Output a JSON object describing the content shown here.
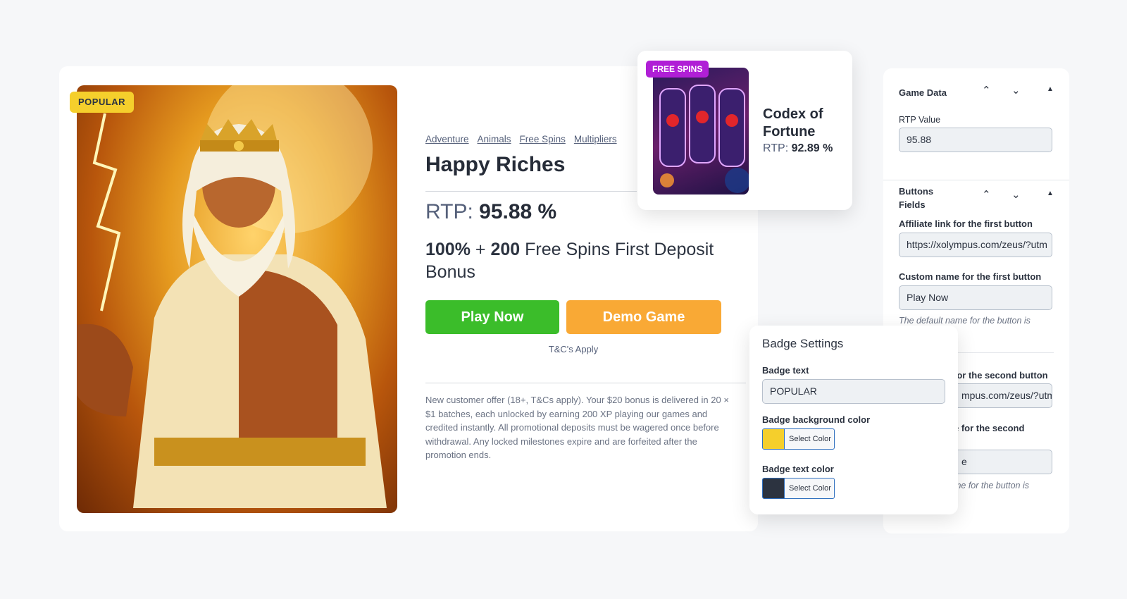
{
  "badge": {
    "text": "POPULAR",
    "bg_color": "#f5cf2c",
    "text_color": "#2c3340"
  },
  "game": {
    "tags": [
      "Adventure",
      "Animals",
      "Free Spins",
      "Multipliers"
    ],
    "title": "Happy Riches",
    "rtp_label": "RTP:",
    "rtp_value": "95.88 %",
    "offer_bold1": "100%",
    "offer_plus": " + ",
    "offer_bold2": "200",
    "offer_rest": " Free Spins First Deposit Bonus",
    "play_label": "Play Now",
    "demo_label": "Demo Game",
    "tc_label": "T&C's Apply",
    "terms": "New customer offer (18+, T&Cs apply). Your $20 bonus is delivered in 20 × $1 batches, each unlocked by earning 200 XP playing our games and credited instantly. All promotional deposits must be wagered once before withdrawal. Any locked milestones expire and are forfeited after the promotion ends.",
    "colors": {
      "play": "#3bbd2a",
      "demo": "#f9a935"
    }
  },
  "related": {
    "badge": "FREE SPINS",
    "name": "Codex of Fortune",
    "rtp_label": "RTP:",
    "rtp_value": "92.89 %"
  },
  "panel": {
    "game_data_title": "Game Data",
    "rtp_label": "RTP Value",
    "rtp_value": "95.88",
    "buttons_title": "Buttons Fields",
    "aff1_label": "Affiliate link for the first button",
    "aff1_value": "https://xolympus.com/zeus/?utm",
    "name1_label": "Custom name for the first button",
    "name1_value": "Play Now",
    "hint1": "The default name for the button is",
    "aff2_label": "for the second button",
    "aff2_value": "mpus.com/zeus/?utm",
    "name2_label": "e for the second",
    "name2_value": "e",
    "hint2": "me for the button is"
  },
  "badge_settings": {
    "title": "Badge Settings",
    "text_label": "Badge text",
    "text_value": "POPULAR",
    "bg_label": "Badge background color",
    "bg_color": "#f5cf2c",
    "text_color_label": "Badge text color",
    "text_color": "#2c3340",
    "select_color": "Select Color"
  }
}
